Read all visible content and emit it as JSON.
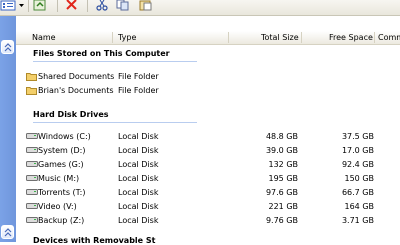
{
  "columns": {
    "name": "Name",
    "type": "Type",
    "total_size": "Total Size",
    "free_space": "Free Space",
    "comments": "Comm"
  },
  "groups": {
    "stored": "Files Stored on This Computer",
    "drives": "Hard Disk Drives",
    "removable": "Devices with Removable St"
  },
  "stored_items": [
    {
      "name": "Shared Documents",
      "type": "File Folder",
      "icon": "folder-icon"
    },
    {
      "name": "Brian's Documents",
      "type": "File Folder",
      "icon": "folder-icon"
    }
  ],
  "drives": [
    {
      "name": "Windows (C:)",
      "type": "Local Disk",
      "total": "48.8 GB",
      "free": "37.5 GB",
      "icon": "hard-drive-icon"
    },
    {
      "name": "System (D:)",
      "type": "Local Disk",
      "total": "39.0 GB",
      "free": "17.0 GB",
      "icon": "hard-drive-icon"
    },
    {
      "name": "Games (G:)",
      "type": "Local Disk",
      "total": "132 GB",
      "free": "92.4 GB",
      "icon": "hard-drive-icon"
    },
    {
      "name": "Music (M:)",
      "type": "Local Disk",
      "total": "195 GB",
      "free": "150 GB",
      "icon": "hard-drive-icon"
    },
    {
      "name": "Torrents (T:)",
      "type": "Local Disk",
      "total": "97.6 GB",
      "free": "66.7 GB",
      "icon": "hard-drive-icon"
    },
    {
      "name": "Video (V:)",
      "type": "Local Disk",
      "total": "221 GB",
      "free": "164 GB",
      "icon": "hard-drive-icon"
    },
    {
      "name": "Backup (Z:)",
      "type": "Local Disk",
      "total": "9.76 GB",
      "free": "3.71 GB",
      "icon": "hard-drive-icon"
    }
  ],
  "toolbar_icons": [
    "views-icon",
    "chevron-down-icon",
    "undo-icon",
    "delete-icon",
    "cut-icon",
    "copy-icon",
    "paste-icon"
  ]
}
